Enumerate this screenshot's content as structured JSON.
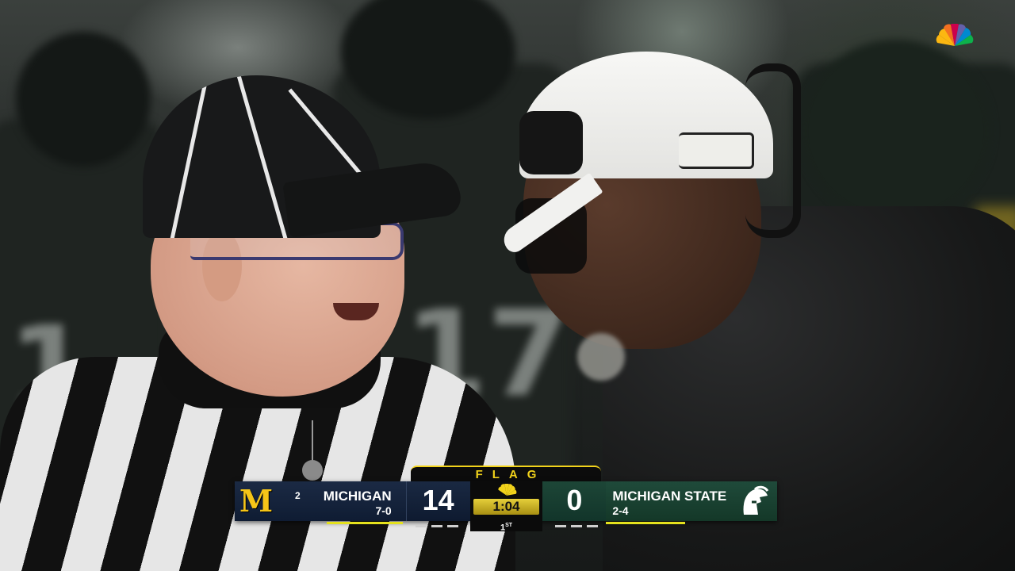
{
  "broadcast": {
    "network_logo_icon": "nbc-peacock-icon"
  },
  "scorebug": {
    "flag_text": "FLAG",
    "home": {
      "logo_letter": "M",
      "rank": "2",
      "name": "MICHIGAN",
      "record": "7-0",
      "score": "14",
      "color": "#0f1c33",
      "logo_color": "#f5c518"
    },
    "away": {
      "name": "MICHIGAN STATE",
      "record": "2-4",
      "score": "0",
      "color": "#143828",
      "logo_icon": "spartan-helmet-icon"
    },
    "clock": "1:04",
    "quarter_num": "1",
    "quarter_suffix": "ST",
    "accent_color": "#e4e11d",
    "flag_color": "#f2d31b"
  }
}
